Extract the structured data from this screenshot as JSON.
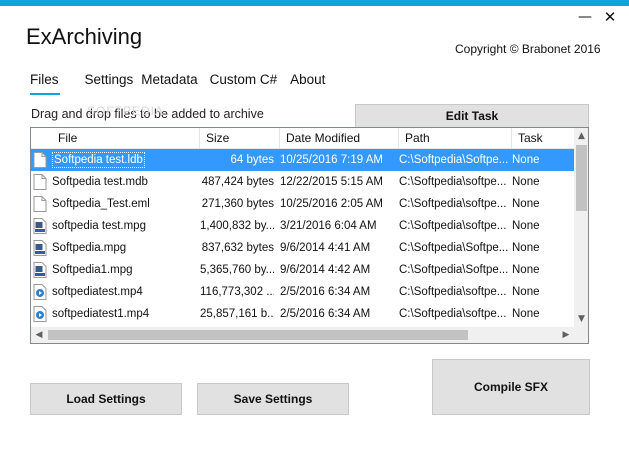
{
  "window": {
    "title": "ExArchiving",
    "copyright": "Copyright © Brabonet 2016",
    "minimize_glyph": "—",
    "close_glyph": "✕"
  },
  "tabs": [
    {
      "label": "Files",
      "active": true
    },
    {
      "label": "Settings",
      "active": false
    },
    {
      "label": "Metadata",
      "active": false
    },
    {
      "label": "Custom C#",
      "active": false
    },
    {
      "label": "About",
      "active": false
    }
  ],
  "files_panel": {
    "drop_label": "Drag and drop files to be added to archive",
    "watermark": "SOFTPEDIA",
    "edit_task_label": "Edit Task",
    "columns": [
      "File",
      "Size",
      "Date Modified",
      "Path",
      "Task"
    ],
    "rows": [
      {
        "icon": "document-icon",
        "file": "Softpedia test.ldb",
        "size": "64 bytes",
        "date": "10/25/2016 7:19 AM",
        "path": "C:\\Softpedia\\Softpe...",
        "task": "None",
        "selected": true
      },
      {
        "icon": "document-icon",
        "file": "Softpedia test.mdb",
        "size": "487,424 bytes",
        "date": "12/22/2015 5:15 AM",
        "path": "C:\\Softpedia\\softpe...",
        "task": "None",
        "selected": false
      },
      {
        "icon": "document-icon",
        "file": "Softpedia_Test.eml",
        "size": "271,360 bytes",
        "date": "10/25/2016 2:05 AM",
        "path": "C:\\Softpedia\\softpe...",
        "task": "None",
        "selected": false
      },
      {
        "icon": "mpeg-file-icon",
        "file": "softpedia test.mpg",
        "size": "1,400,832 by...",
        "date": "3/21/2016 6:04 AM",
        "path": "C:\\Softpedia\\softpe...",
        "task": "None",
        "selected": false
      },
      {
        "icon": "mpeg-file-icon",
        "file": "Softpedia.mpg",
        "size": "837,632 bytes",
        "date": "9/6/2014 4:41 AM",
        "path": "C:\\Softpedia\\Softpe...",
        "task": "None",
        "selected": false
      },
      {
        "icon": "mpeg-file-icon",
        "file": "Softpedia1.mpg",
        "size": "5,365,760 by...",
        "date": "9/6/2014 4:42 AM",
        "path": "C:\\Softpedia\\Softpe...",
        "task": "None",
        "selected": false
      },
      {
        "icon": "video-file-icon",
        "file": "softpediatest.mp4",
        "size": "116,773,302 ...",
        "date": "2/5/2016 6:34 AM",
        "path": "C:\\Softpedia\\softpe...",
        "task": "None",
        "selected": false
      },
      {
        "icon": "video-file-icon",
        "file": "softpediatest1.mp4",
        "size": "25,857,161 b...",
        "date": "2/5/2016 6:34 AM",
        "path": "C:\\Softpedia\\softpe...",
        "task": "None",
        "selected": false
      }
    ]
  },
  "buttons": {
    "load_settings": "Load Settings",
    "save_settings": "Save Settings",
    "compile_sfx": "Compile SFX"
  },
  "colors": {
    "accent": "#12a3dc",
    "selection": "#3399ff"
  }
}
